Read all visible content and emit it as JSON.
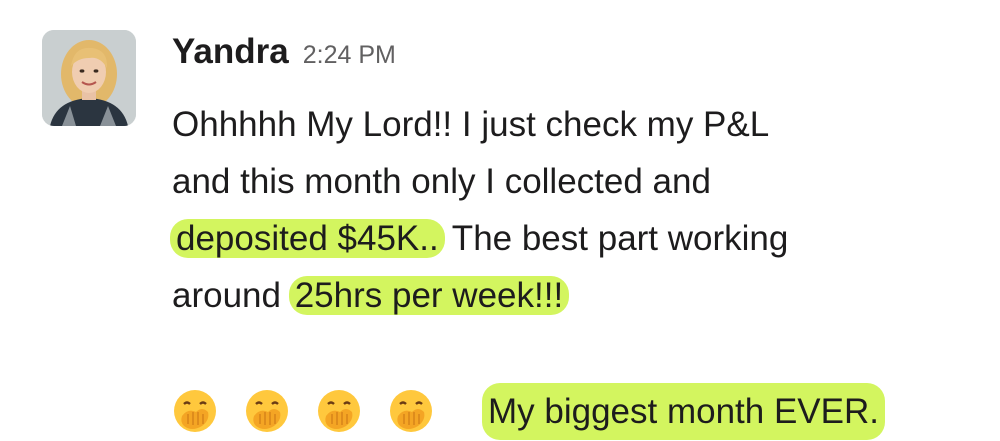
{
  "message": {
    "sender": "Yandra",
    "timestamp": "2:24 PM",
    "lines": [
      {
        "plain_before": "Ohhhhh My Lord!! I just check my P&L",
        "highlight": "",
        "plain_after": ""
      },
      {
        "plain_before": "and this month only I collected and",
        "highlight": "",
        "plain_after": ""
      },
      {
        "plain_before": "",
        "highlight": "deposited  $45K..",
        "plain_after": " The best part working"
      },
      {
        "plain_before": "around ",
        "highlight": "25hrs per week!!!",
        "plain_after": ""
      }
    ],
    "emoji_icon": "face-with-hand-over-mouth",
    "emoji_count": 4,
    "closing_highlight": "My biggest month EVER.",
    "highlight_color": "#d3f55f"
  }
}
